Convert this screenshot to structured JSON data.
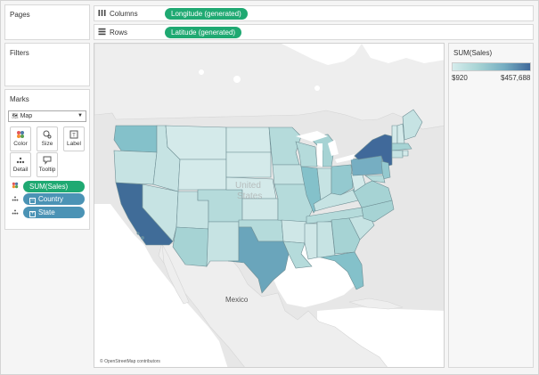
{
  "panels": {
    "pages": "Pages",
    "filters": "Filters",
    "marks": "Marks"
  },
  "shelves": {
    "columns_label": "Columns",
    "rows_label": "Rows",
    "columns_pill": "Longitude (generated)",
    "rows_pill": "Latitude (generated)"
  },
  "marks": {
    "mark_type": "Map",
    "buttons": [
      {
        "label": "Color",
        "icon": "color-dots-icon"
      },
      {
        "label": "Size",
        "icon": "size-icon"
      },
      {
        "label": "Label",
        "icon": "label-icon"
      },
      {
        "label": "Detail",
        "icon": "detail-dots-icon"
      },
      {
        "label": "Tooltip",
        "icon": "tooltip-icon"
      }
    ],
    "fields": [
      {
        "label": "SUM(Sales)",
        "color": "#1fa972"
      },
      {
        "label": "Country",
        "color": "#4b93b5"
      },
      {
        "label": "State",
        "color": "#4b93b5"
      }
    ]
  },
  "legend": {
    "title": "SUM(Sales)",
    "min": "$920",
    "max": "$457,688",
    "color_low": "#d5ecec",
    "color_high": "#40699a"
  },
  "map": {
    "country_label": "United States",
    "country_label_line1": "United",
    "country_label_line2": "States",
    "mexico_label": "Mexico",
    "attribution": "© OpenStreetMap contributors"
  }
}
